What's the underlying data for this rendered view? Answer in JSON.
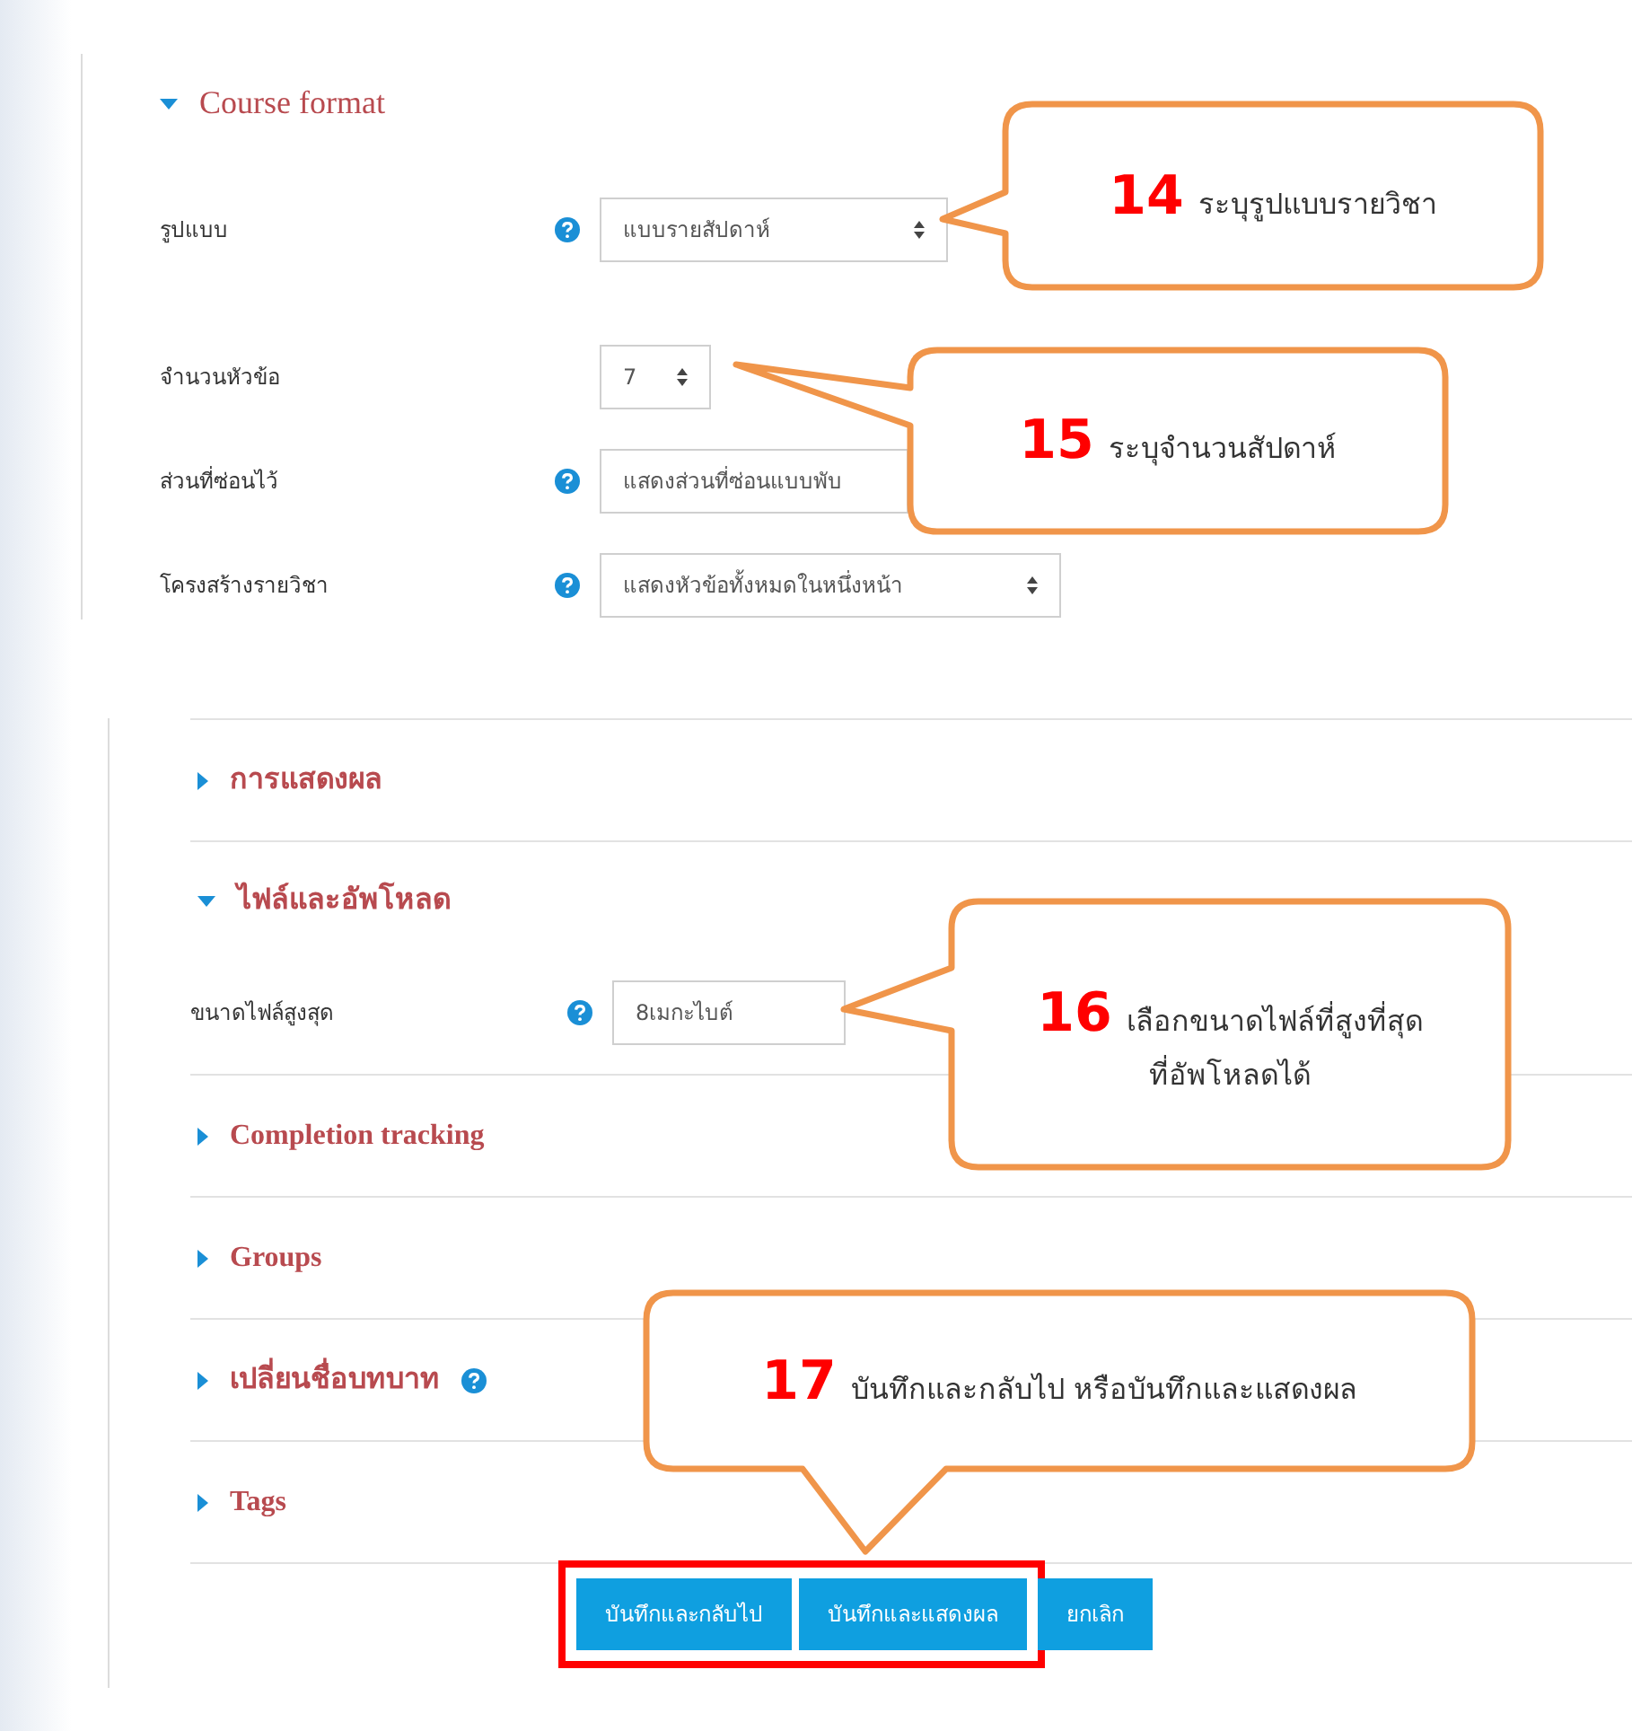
{
  "top_panel": {
    "section": {
      "title": "Course format",
      "expanded": true
    },
    "rows": [
      {
        "label": "รูปแบบ",
        "help": true,
        "value": "แบบรายสัปดาห์",
        "arrow": true
      },
      {
        "label": "จำนวนหัวข้อ",
        "help": false,
        "value": "7",
        "arrow": true
      },
      {
        "label": "ส่วนที่ซ่อนไว้",
        "help": true,
        "value": "แสดงส่วนที่ซ่อนแบบพับ",
        "arrow": false
      },
      {
        "label": "โครงสร้างรายวิชา",
        "help": true,
        "value": "แสดงหัวข้อทั้งหมดในหนึ่งหน้า",
        "arrow": true
      }
    ]
  },
  "bottom_panel": {
    "sections": [
      {
        "title": "การแสดงผล",
        "expanded": false,
        "help": false
      },
      {
        "title": "ไฟล์และอัพโหลด",
        "expanded": true,
        "help": false,
        "rows": [
          {
            "label": "ขนาดไฟล์สูงสุด",
            "help": true,
            "value": "8เมกะไบต์",
            "arrow": false
          }
        ]
      },
      {
        "title": "Completion tracking",
        "expanded": false,
        "help": false
      },
      {
        "title": "Groups",
        "expanded": false,
        "help": false
      },
      {
        "title": "เปลี่ยนชื่อบทบาท",
        "expanded": false,
        "help": true
      },
      {
        "title": "Tags",
        "expanded": false,
        "help": false
      }
    ]
  },
  "button_groups": [
    {
      "highlighted": true,
      "buttons": [
        "บันทึกและกลับไป",
        "บันทึกและแสดงผล"
      ]
    },
    {
      "highlighted": false,
      "buttons": [
        "ยกเลิก"
      ]
    }
  ],
  "callouts": [
    {
      "number": "14",
      "lines": [
        "ระบุรูปแบบรายวิชา"
      ]
    },
    {
      "number": "15",
      "lines": [
        "ระบุจำนวนสัปดาห์"
      ]
    },
    {
      "number": "16",
      "lines": [
        "เลือกขนาดไฟล์ที่สูงที่สุด",
        "ที่อัพโหลดได้"
      ]
    },
    {
      "number": "17",
      "lines": [
        "บันทึกและกลับไป หรือบันทึกและแสดงผล"
      ]
    }
  ]
}
